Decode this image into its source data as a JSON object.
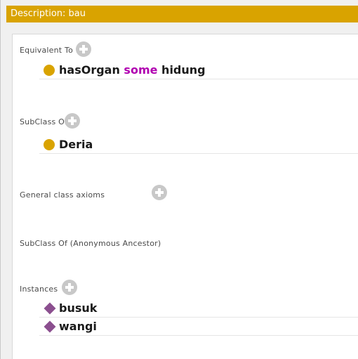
{
  "window": {
    "title": "Description: bau"
  },
  "sections": {
    "equivalent_to": {
      "label": "Equivalent To",
      "expression": {
        "property": "hasOrgan",
        "keyword": "some",
        "filler": "hidung"
      }
    },
    "subclass_of": {
      "label": "SubClass Of",
      "items": [
        "Deria"
      ]
    },
    "general_class_axioms": {
      "label": "General class axioms"
    },
    "subclass_of_anonymous": {
      "label": "SubClass Of (Anonymous Ancestor)"
    },
    "instances": {
      "label": "Instances",
      "items": [
        "busuk",
        "wangi"
      ]
    }
  },
  "icons": {
    "add": "plus-circle-icon",
    "class": "class-circle-icon",
    "individual": "individual-diamond-icon"
  },
  "colors": {
    "title_bar": "#d9a300",
    "class_icon": "#d9a300",
    "individual_icon": "#8b4f8f",
    "keyword": "#b000b0",
    "add_button": "#c8c8c8"
  }
}
